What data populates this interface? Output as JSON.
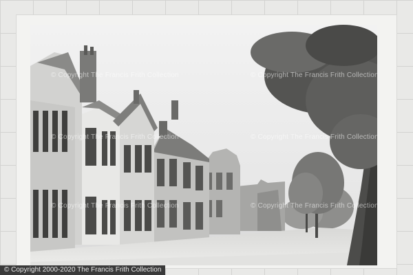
{
  "watermark": "© Copyright The Francis Frith Collection",
  "credit": "© Copyright 2000-2020 The Francis Frith Collection"
}
